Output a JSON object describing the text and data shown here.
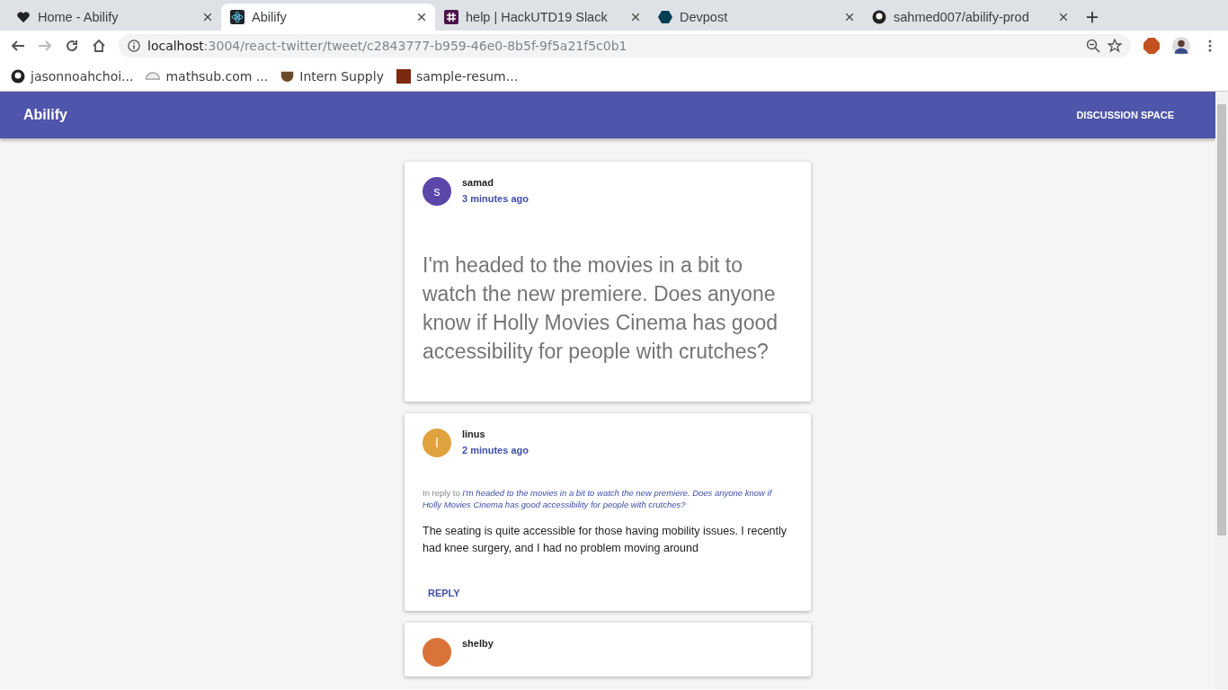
{
  "browser": {
    "tabs": [
      {
        "title": "Home - Abilify",
        "selected": false
      },
      {
        "title": "Abilify",
        "selected": true
      },
      {
        "title": "help | HackUTD19 Slack",
        "selected": false
      },
      {
        "title": "Devpost",
        "selected": false
      },
      {
        "title": "sahmed007/abilify-prod",
        "selected": false
      }
    ],
    "url_host": "localhost",
    "url_path": ":3004/react-twitter/tweet/c2843777-b959-46e0-8b5f-9f5a21f5c0b1",
    "bookmarks": [
      {
        "title": "jasonnoahchoi..."
      },
      {
        "title": "mathsub.com ..."
      },
      {
        "title": "Intern Supply"
      },
      {
        "title": "sample-resum..."
      }
    ]
  },
  "app": {
    "title": "Abilify",
    "nav": "DISCUSSION SPACE"
  },
  "posts": [
    {
      "kind": "main",
      "initial": "s",
      "color": "#5c47a8",
      "author": "samad",
      "time": "3 minutes ago",
      "text": "I'm headed to the movies in a bit to watch the new premiere. Does anyone know if Holly Movies Cinema has good accessibility for people with crutches?"
    },
    {
      "kind": "reply",
      "initial": "l",
      "color": "#e0a23e",
      "author": "linus",
      "time": "2 minutes ago",
      "reply_label": "In reply to",
      "reply_quote": "I'm headed to the movies in a bit to watch the new premiere. Does anyone know if Holly Movies Cinema has good accessibility for people with crutches?",
      "text": "The seating is quite accessible for those having mobility issues. I recently had knee surgery, and I had no problem moving around",
      "action": "REPLY"
    },
    {
      "kind": "cut",
      "color": "#d9733a",
      "author": "shelby"
    }
  ]
}
